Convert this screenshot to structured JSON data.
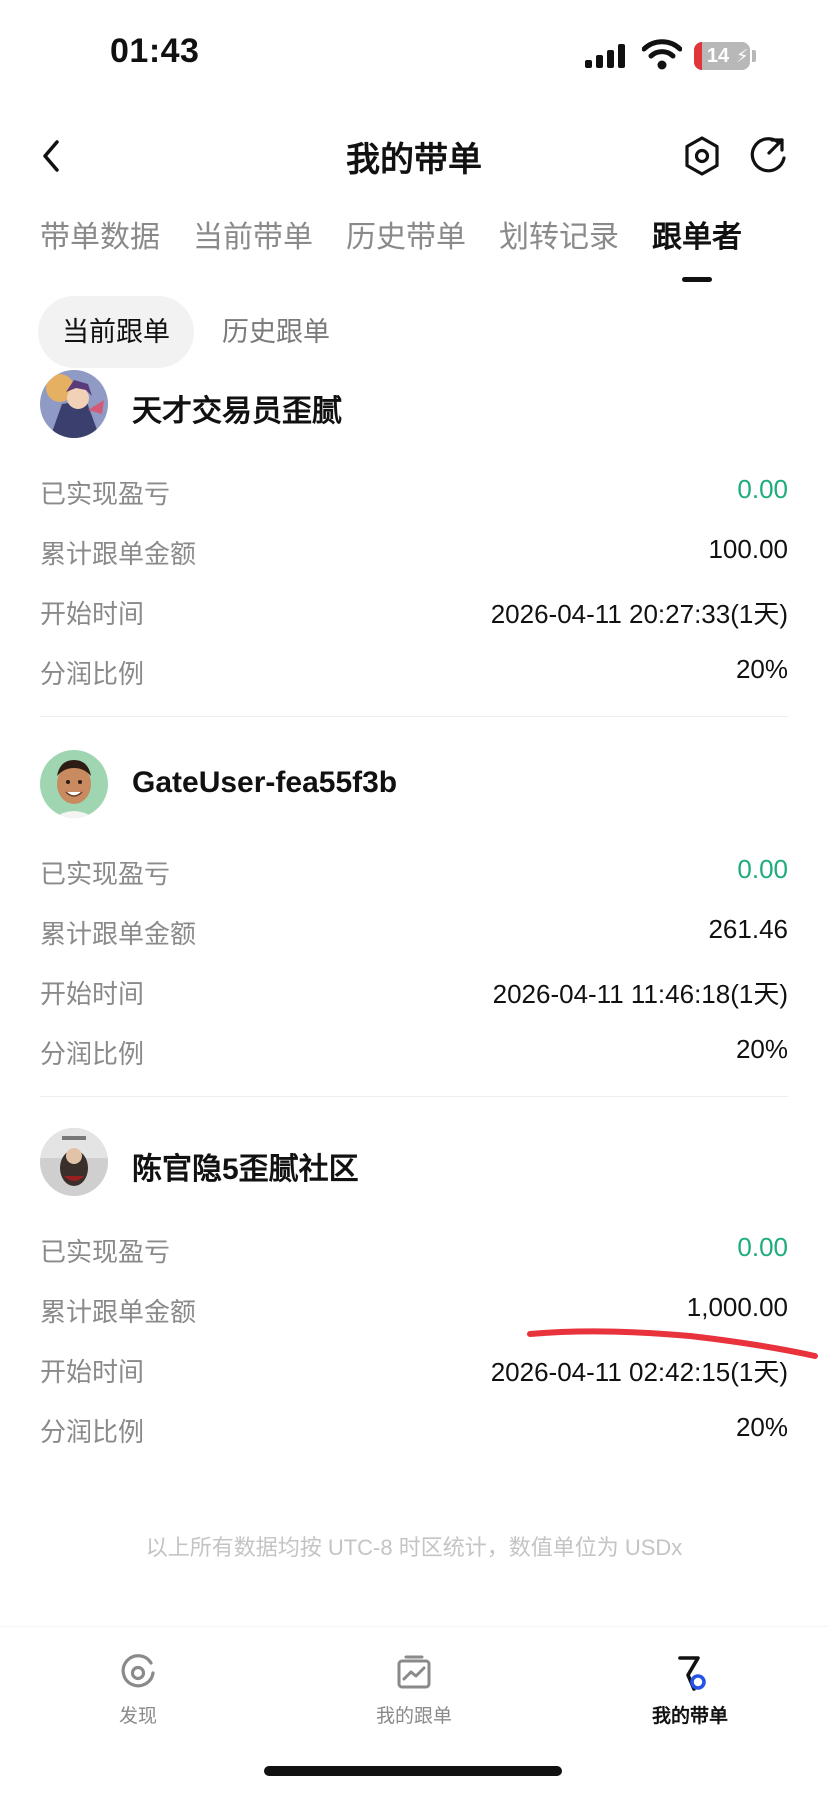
{
  "status_bar": {
    "time": "01:43",
    "battery_level": "14"
  },
  "header": {
    "title": "我的带单"
  },
  "main_tabs": [
    {
      "label": "带单数据",
      "active": false
    },
    {
      "label": "当前带单",
      "active": false
    },
    {
      "label": "历史带单",
      "active": false
    },
    {
      "label": "划转记录",
      "active": false
    },
    {
      "label": "跟单者",
      "active": true
    }
  ],
  "sub_tabs": [
    {
      "label": "当前跟单",
      "active": true
    },
    {
      "label": "历史跟单",
      "active": false
    }
  ],
  "followers": [
    {
      "name": "天才交易员歪腻",
      "rows": [
        {
          "label": "已实现盈亏",
          "value": "0.00"
        },
        {
          "label": "累计跟单金额",
          "value": "100.00"
        },
        {
          "label": "开始时间",
          "value": "2026-04-11 20:27:33(1天)"
        },
        {
          "label": "分润比例",
          "value": "20%"
        }
      ]
    },
    {
      "name": "GateUser-fea55f3b",
      "rows": [
        {
          "label": "已实现盈亏",
          "value": "0.00"
        },
        {
          "label": "累计跟单金额",
          "value": "261.46"
        },
        {
          "label": "开始时间",
          "value": "2026-04-11 11:46:18(1天)"
        },
        {
          "label": "分润比例",
          "value": "20%"
        }
      ]
    },
    {
      "name": "陈官隐5歪腻社区",
      "rows": [
        {
          "label": "已实现盈亏",
          "value": "0.00"
        },
        {
          "label": "累计跟单金额",
          "value": "1,000.00"
        },
        {
          "label": "开始时间",
          "value": "2026-04-11 02:42:15(1天)"
        },
        {
          "label": "分润比例",
          "value": "20%"
        }
      ]
    }
  ],
  "footnote": "以上所有数据均按 UTC-8 时区统计，数值单位为 USDx",
  "bottom_nav": [
    {
      "label": "发现",
      "icon": "discover-icon",
      "active": false
    },
    {
      "label": "我的跟单",
      "icon": "chart-icon",
      "active": false
    },
    {
      "label": "我的带单",
      "icon": "lead-trading-icon",
      "active": true
    }
  ],
  "colors": {
    "profit_green": "#1dac7d",
    "annotation_red": "#e8323c",
    "accent_blue": "#2354e6"
  }
}
